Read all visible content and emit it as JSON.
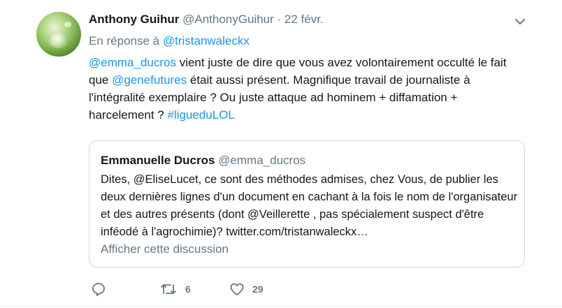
{
  "tweet": {
    "fullname": "Anthony Guihur",
    "handle": "@AnthonyGuihur",
    "separator": "·",
    "time": "22 févr.",
    "reply_prefix": "En réponse à ",
    "reply_handle": "@tristanwaleckx",
    "text": {
      "mention1": "@emma_ducros",
      "part1": " vient juste de dire que vous avez volontairement occulté le fait que ",
      "mention2": "@genefutures",
      "part2": " était aussi présent. Magnifique travail de journaliste à l'intégralité exemplaire ? Ou juste attaque ad hominem + diffamation + harcelement ? ",
      "hashtag": "#ligueduLOL"
    }
  },
  "quote": {
    "fullname": "Emmanuelle Ducros",
    "handle": "@emma_ducros",
    "text": "Dites, @EliseLucet, ce sont des méthodes admises, chez Vous, de publier les deux dernières lignes d'un document en cachant à la fois le nom de l'organisateur et des autres présents (dont @Veillerette , pas spécialement suspect d'être inféodé à l'agrochimie)? twitter.com/tristanwaleckx…",
    "show_thread": "Afficher cette discussion"
  },
  "actions": {
    "reply_icon": "reply-icon",
    "retweet_icon": "retweet-icon",
    "retweet_count": "6",
    "like_icon": "heart-icon",
    "like_count": "29"
  },
  "colors": {
    "link": "#1b95e0",
    "secondary": "#657786",
    "border": "#ccd6dd"
  }
}
